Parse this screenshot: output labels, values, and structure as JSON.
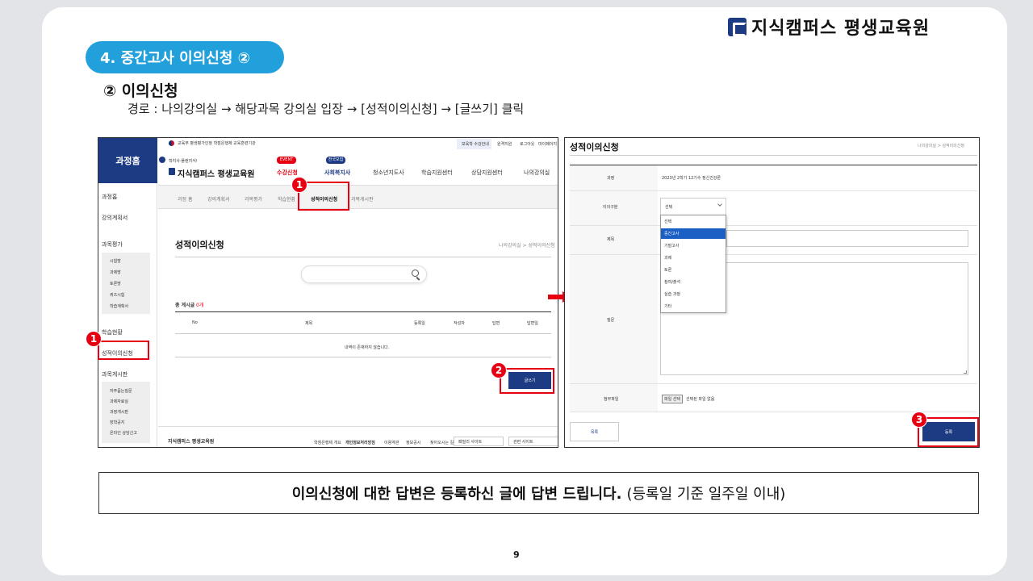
{
  "brand": {
    "name": "지식캠퍼스 평생교육원"
  },
  "section": {
    "title": "4. 중간고사 이의신청 ②",
    "step_title": "② 이의신청",
    "path": "경로 : 나의강의실 → 해당과목 강의실 입장 → [성적이의신청] → [글쓰기] 클릭"
  },
  "left": {
    "top_notice": "교육부 평생평가인정 학점은행제 교육훈련기관",
    "top_links": [
      "보육학 수강안내",
      "원격지원",
      "로그아웃",
      "마이페이지"
    ],
    "sidebar_title": "과정홈",
    "sidebar_items": [
      "과정홈",
      "강의계획서",
      "과목평가",
      "학습현황",
      "성적이의신청",
      "과목게시판"
    ],
    "sidebar_sub1": [
      "시험방",
      "과제방",
      "토론방",
      "퀴즈시험",
      "학습계획서"
    ],
    "sidebar_sub2": [
      "자주묻는질문",
      "과제자료실",
      "과정게시판",
      "장학공지",
      "온라인 상담신고"
    ],
    "logo_sub": "학지사·플랜지식!",
    "logo_name": "지식캠퍼스 평생교육원",
    "event_badge": "EVENT",
    "event_label": "수강신청",
    "new_badge": "전국모집",
    "new_label": "사회복지사",
    "nav": [
      "청소년지도사",
      "학습지원센터",
      "상담지원센터",
      "나의강의실"
    ],
    "tabs": [
      "과정 홈",
      "강의계획서",
      "과목평가",
      "학습현황",
      "성적이의신청",
      "과목게시판"
    ],
    "page_title": "성적이의신청",
    "crumb": "나의강의실 > 성적이의신청",
    "total_label": "총 게시글",
    "total_count": "0개",
    "columns": [
      "No",
      "제목",
      "등록일",
      "작성자",
      "답변",
      "답변일"
    ],
    "empty": "내역이 존재하지 않습니다.",
    "write": "글쓰기",
    "footer_logo": "지식캠퍼스 평생교육원",
    "footer_links": [
      "학점은행제 개요",
      "개인정보처리방침",
      "이용약관",
      "정보공시",
      "찾아오시는 길"
    ],
    "footer_select1": "패밀리 사이트",
    "footer_select2": "관련 사이트"
  },
  "right": {
    "title": "성적이의신청",
    "crumb": "나의강의실 > 성적이의신청",
    "row_course_label": "과정",
    "row_course_value": "2023년 2학기 12기수 정신건강론",
    "row_type_label": "이의구분",
    "select_value": "선택",
    "options": [
      "선택",
      "중간고사",
      "기말고사",
      "과제",
      "토론",
      "참여/출석",
      "실습 과정",
      "기타"
    ],
    "row_subject_label": "제목",
    "row_body_label": "질문",
    "row_file_label": "첨부파일",
    "file_button": "파일 선택",
    "file_none": "선택된 파일 없음",
    "list_button": "목록",
    "submit_button": "등록"
  },
  "markers": [
    "1",
    "1",
    "2",
    "3"
  ],
  "note": {
    "bold": "이의신청에 대한 답변은 등록하신 글에 답변 드립니다.",
    "rest": "(등록일 기준 일주일 이내)"
  },
  "page_number": "9",
  "colors": {
    "accent": "#22a0db",
    "navy": "#1c3b83",
    "marker": "#e60012"
  }
}
